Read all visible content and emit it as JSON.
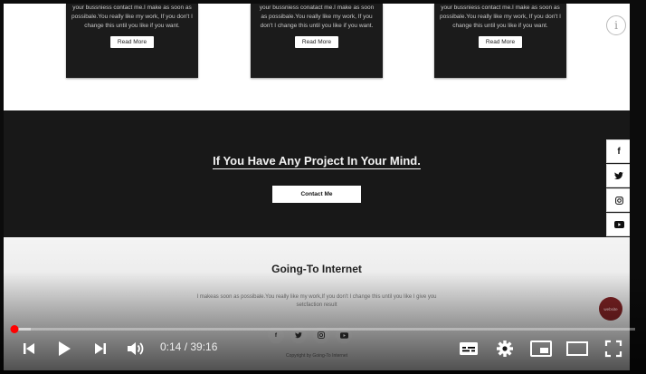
{
  "cards": [
    {
      "text": "your bussniess contact me.I make as soon as possibale.You really like my work, If you don't I change this until you like if you want.",
      "button": "Read More"
    },
    {
      "text": "your bussniess conatact me.I make as soon as possibale.You really like my work, If you don't I change this until you like if you want.",
      "button": "Read More"
    },
    {
      "text": "your bussniess contact me.I make as soon as possibale.You really like my work, If you don't I change this until you like if you want.",
      "button": "Read More"
    }
  ],
  "banner": {
    "title": "If You Have Any Project In Your Mind.",
    "button": "Contact Me"
  },
  "side_social": [
    "f",
    "t",
    "ig",
    "yt"
  ],
  "footer": {
    "title": "Going-To Internet",
    "desc": "I makeas soon as possibale.You really like my work,If you don't I change this until you like I give you setcfaction result",
    "icons": [
      "f",
      "t",
      "ig",
      "yt"
    ],
    "copyright": "Copyright by Going-To Internet",
    "badge": "website"
  },
  "player": {
    "current": "0:14",
    "separator": " / ",
    "duration": "39:16",
    "progress_played": 0.006,
    "progress_buffered": 0.032
  },
  "icons": {
    "info": "info-icon",
    "prev": "skip-previous-icon",
    "play": "play-icon",
    "next": "skip-next-icon",
    "volume": "volume-icon",
    "captions": "subtitles-icon",
    "settings": "gear-icon",
    "miniplayer": "miniplayer-icon",
    "theater": "theater-mode-icon",
    "fullscreen": "fullscreen-icon"
  },
  "colors": {
    "accent": "#ff0000",
    "card_bg": "#1b1b1b",
    "banner_bg": "#181818"
  }
}
